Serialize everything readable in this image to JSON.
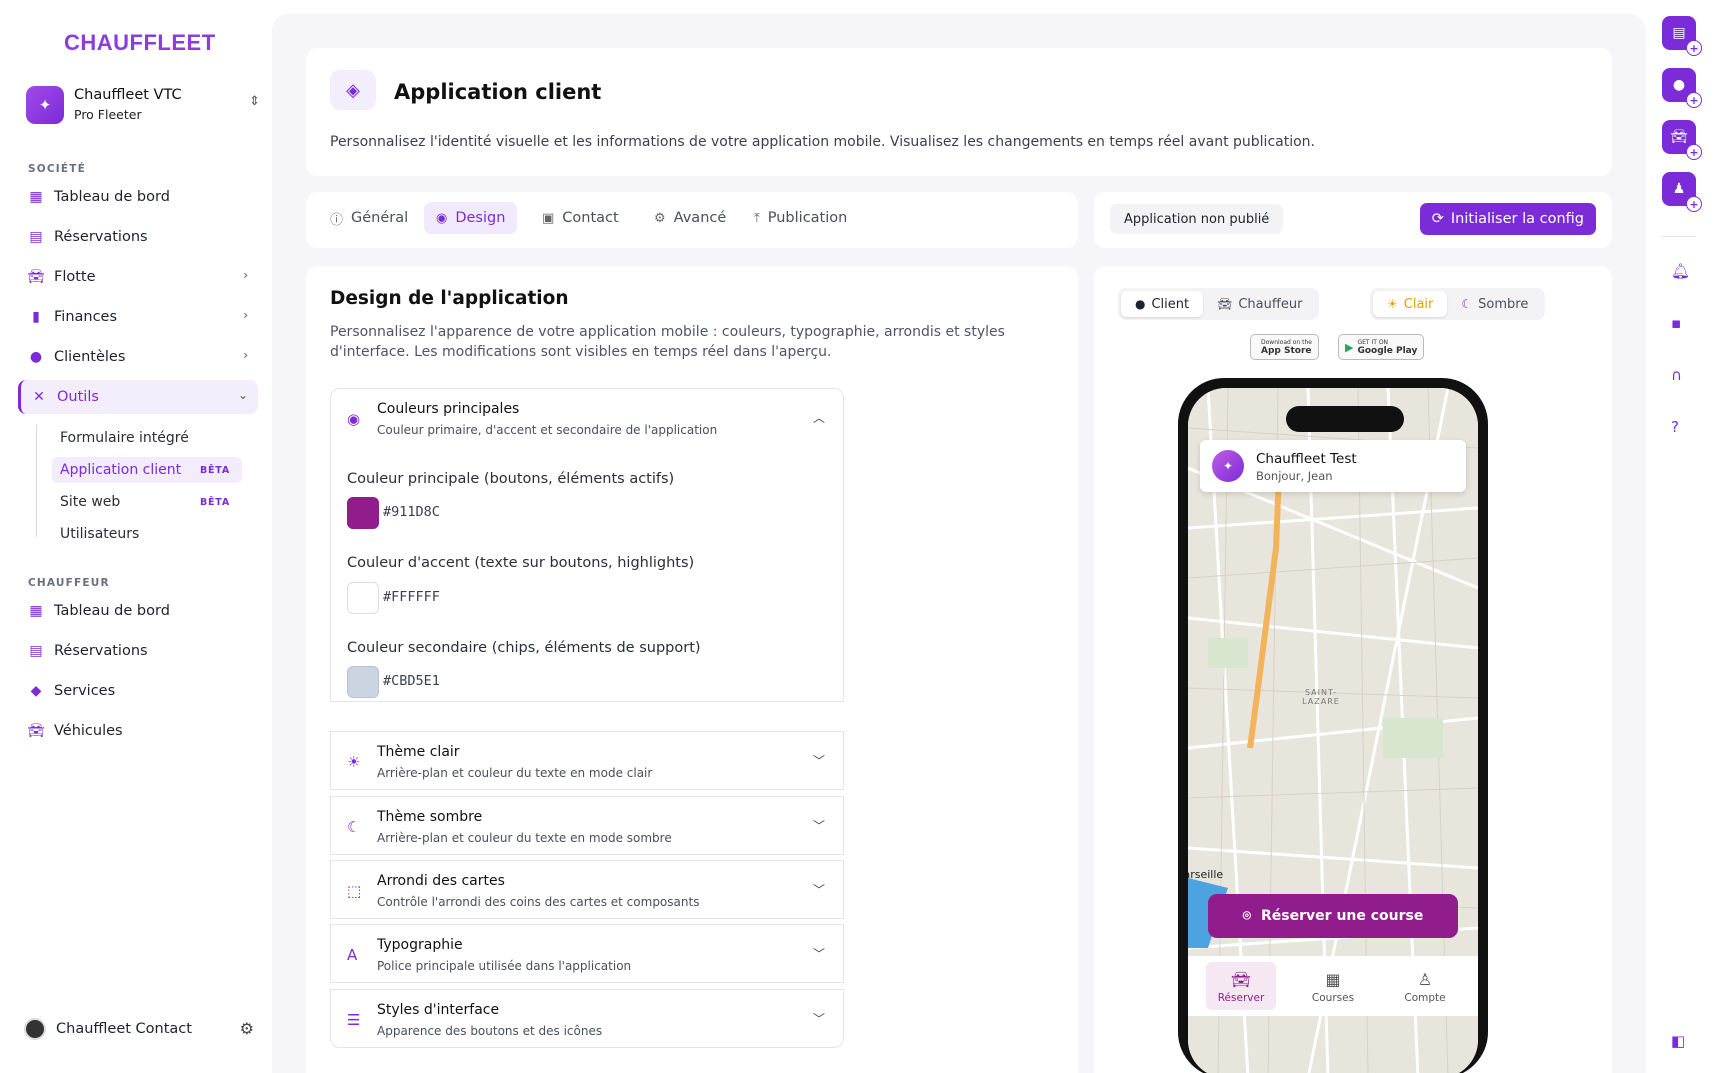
{
  "sidebar": {
    "logo": "CHAUFFLEET",
    "org_name": "Chauffleet VTC",
    "org_plan": "Pro Fleeter",
    "section_company": "SOCIÉTÉ",
    "company_items": [
      "Tableau de bord",
      "Réservations",
      "Flotte",
      "Finances",
      "Clientèles",
      "Outils"
    ],
    "tools_sub": [
      "Formulaire intégré",
      "Application client",
      "Site web",
      "Utilisateurs"
    ],
    "beta": "BÊTA",
    "section_driver": "CHAUFFEUR",
    "driver_items": [
      "Tableau de bord",
      "Réservations",
      "Services",
      "Véhicules"
    ],
    "user_name": "Chauffleet Contact"
  },
  "header": {
    "title": "Application client",
    "description": "Personnalisez l'identité visuelle et les informations de votre application mobile. Visualisez les changements en temps réel avant publication."
  },
  "tabs": [
    "Général",
    "Design",
    "Contact",
    "Avancé",
    "Publication"
  ],
  "status": {
    "label": "Application non publié",
    "init_button": "Initialiser la config"
  },
  "design": {
    "title": "Design de l'application",
    "description": "Personnalisez l'apparence de votre application mobile : couleurs, typographie, arrondis et styles d'interface. Les modifications sont visibles en temps réel dans l'aperçu.",
    "colors_title": "Couleurs principales",
    "colors_sub": "Couleur primaire, d'accent et secondaire de l'application",
    "primary_label": "Couleur principale (boutons, éléments actifs)",
    "primary_hex": "#911D8C",
    "accent_label": "Couleur d'accent (texte sur boutons, highlights)",
    "accent_hex": "#FFFFFF",
    "secondary_label": "Couleur secondaire (chips, éléments de support)",
    "secondary_hex": "#CBD5E1",
    "sections": [
      {
        "title": "Thème clair",
        "sub": "Arrière-plan et couleur du texte en mode clair"
      },
      {
        "title": "Thème sombre",
        "sub": "Arrière-plan et couleur du texte en mode sombre"
      },
      {
        "title": "Arrondi des cartes",
        "sub": "Contrôle l'arrondi des coins des cartes et composants"
      },
      {
        "title": "Typographie",
        "sub": "Police principale utilisée dans l'application"
      },
      {
        "title": "Styles d'interface",
        "sub": "Apparence des boutons et des icônes"
      }
    ]
  },
  "preview": {
    "role_client": "Client",
    "role_driver": "Chauffeur",
    "theme_light": "Clair",
    "theme_dark": "Sombre",
    "appstore_small": "Download on the",
    "appstore": "App Store",
    "gplay_small": "GET IT ON",
    "gplay": "Google Play",
    "app_name": "Chauffleet Test",
    "greeting": "Bonjour, Jean",
    "book_button": "Réserver une course",
    "nav": [
      "Réserver",
      "Courses",
      "Compte"
    ],
    "map_labels": [
      "SAINT-LAZARE",
      "Marseille"
    ]
  },
  "colors": {
    "brand": "#7b2bd8",
    "app_primary": "#911d8c"
  }
}
